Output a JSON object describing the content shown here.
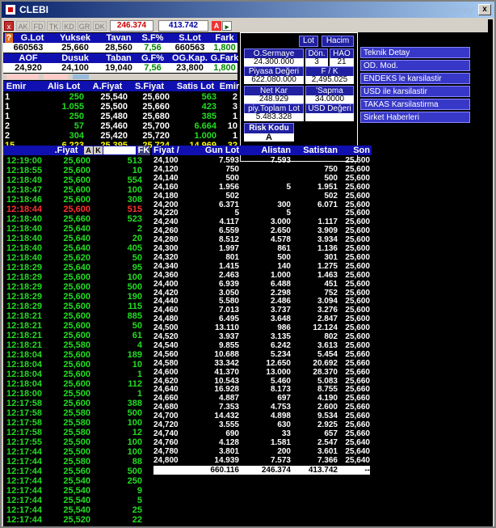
{
  "window": {
    "title": "CLEBI",
    "ghost_title": "Detay",
    "close": "x"
  },
  "toolbar": {
    "close_mark": "x",
    "tabs": [
      "AK",
      "FD",
      "TK",
      "KD",
      "GR",
      "DK"
    ],
    "price1": "246.374",
    "price2": "413.742",
    "a_label": "A"
  },
  "summary": {
    "headers1": [
      "?",
      "G.Lot",
      "Yuksek",
      "Tavan",
      "S.F%",
      "S.Lot",
      "Fark"
    ],
    "values1": [
      "660563",
      "25,660",
      "28,560",
      "7,56",
      "660563",
      "1,800"
    ],
    "headers2": [
      "AOF",
      "Dusuk",
      "Taban",
      "G.F%",
      "OG.Kap.",
      "G.Fark"
    ],
    "values2": [
      "24,920",
      "24,100",
      "19,040",
      "7,56",
      "23,800",
      "1,800"
    ]
  },
  "depth": {
    "headers": [
      "Emir",
      "Alis Lot",
      "A.Fiyat",
      "S.Fiyat",
      "Satis Lot",
      "Emir"
    ],
    "rows": [
      [
        "1",
        "250",
        "25,540",
        "25,600",
        "563",
        "2"
      ],
      [
        "1",
        "1.055",
        "25,500",
        "25,660",
        "423",
        "3"
      ],
      [
        "1",
        "250",
        "25,480",
        "25,680",
        "385",
        "1"
      ],
      [
        "2",
        "57",
        "25,460",
        "25,700",
        "6.664",
        "10"
      ],
      [
        "2",
        "304",
        "25,420",
        "25,720",
        "1.000",
        "1"
      ]
    ],
    "totals": [
      "15",
      "6.223",
      "25,395",
      "25,724",
      "14.969",
      "32"
    ]
  },
  "info": {
    "lot_btn": "Lot",
    "hacim_btn": "Hacim",
    "labels": {
      "sermaye": "O.Sermaye",
      "don": "Dön.",
      "hao": "HAO",
      "piyasa": "Piyasa Değeri",
      "fk": "F / K",
      "netkar": "Net Kar",
      "sapma": "'Sapma",
      "toplam": "piy.Toplam Lot",
      "usd": "USD Değeri",
      "risk": "Risk Kodu"
    },
    "values": {
      "sermaye": "24.300.000",
      "don": "3",
      "hao": "21",
      "piyasa": "622.080.000",
      "fk": "2,495.025",
      "netkar": "248.929",
      "sapma": "34.0000",
      "toplam": "5.483.328",
      "risk": "A"
    }
  },
  "menu": [
    "Teknik Detay",
    "OD. Mod.",
    "ENDEKS le karsilastir",
    "USD ile karsilastir",
    "TAKAS Karsilastirma",
    "Sirket Haberleri"
  ],
  "tape": {
    "headers": [
      "",
      ".Fiyat",
      "",
      "FK"
    ],
    "ak": [
      "A",
      "K"
    ],
    "rows": [
      [
        "12:19:00",
        "25,600",
        "513"
      ],
      [
        "12:18:55",
        "25,600",
        "10"
      ],
      [
        "12:18:49",
        "25,600",
        "554"
      ],
      [
        "12:18:47",
        "25,600",
        "100"
      ],
      [
        "12:18:46",
        "25,600",
        "308"
      ],
      [
        "12:18:44",
        "25,600",
        "515"
      ],
      [
        "12:18:40",
        "25,660",
        "523"
      ],
      [
        "12:18:40",
        "25,640",
        "2"
      ],
      [
        "12:18:40",
        "25,640",
        "20"
      ],
      [
        "12:18:40",
        "25,640",
        "405"
      ],
      [
        "12:18:40",
        "25,620",
        "50"
      ],
      [
        "12:18:29",
        "25,640",
        "95"
      ],
      [
        "12:18:29",
        "25,600",
        "100"
      ],
      [
        "12:18:29",
        "25,600",
        "500"
      ],
      [
        "12:18:29",
        "25,600",
        "190"
      ],
      [
        "12:18:29",
        "25,600",
        "115"
      ],
      [
        "12:18:21",
        "25,600",
        "885"
      ],
      [
        "12:18:21",
        "25,600",
        "50"
      ],
      [
        "12:18:21",
        "25,600",
        "61"
      ],
      [
        "12:18:21",
        "25,580",
        "4"
      ],
      [
        "12:18:04",
        "25,600",
        "189"
      ],
      [
        "12:18:04",
        "25,600",
        "10"
      ],
      [
        "12:18:04",
        "25,600",
        "1"
      ],
      [
        "12:18:04",
        "25,600",
        "112"
      ],
      [
        "12:18:00",
        "25,500",
        "1"
      ],
      [
        "12:17:58",
        "25,600",
        "388"
      ],
      [
        "12:17:58",
        "25,580",
        "500"
      ],
      [
        "12:17:58",
        "25,580",
        "100"
      ],
      [
        "12:17:58",
        "25,580",
        "12"
      ],
      [
        "12:17:55",
        "25,500",
        "100"
      ],
      [
        "12:17:44",
        "25,500",
        "100"
      ],
      [
        "12:17:44",
        "25,580",
        "88"
      ],
      [
        "12:17:44",
        "25,560",
        "500"
      ],
      [
        "12:17:44",
        "25,540",
        "250"
      ],
      [
        "12:17:44",
        "25,540",
        "9"
      ],
      [
        "12:17:44",
        "25,540",
        "5"
      ],
      [
        "12:17:44",
        "25,540",
        "25"
      ],
      [
        "12:17:44",
        "25,520",
        "22"
      ]
    ]
  },
  "priceladder": {
    "headers": [
      "Fiyat /",
      "Gun Lot",
      "Alistan",
      "Satistan",
      "Son"
    ],
    "rows": [
      [
        "24,100",
        "7.593",
        "7.593",
        "",
        "25,600"
      ],
      [
        "24,120",
        "750",
        "",
        "750",
        "25,600"
      ],
      [
        "24,140",
        "500",
        "",
        "500",
        "25,600"
      ],
      [
        "24,160",
        "1.956",
        "5",
        "1.951",
        "25,600"
      ],
      [
        "24,180",
        "502",
        "",
        "502",
        "25,600"
      ],
      [
        "24,200",
        "6.371",
        "300",
        "6.071",
        "25,600"
      ],
      [
        "24,220",
        "5",
        "5",
        "",
        "25,600"
      ],
      [
        "24,240",
        "4.117",
        "3.000",
        "1.117",
        "25,600"
      ],
      [
        "24,260",
        "6.559",
        "2.650",
        "3.909",
        "25,600"
      ],
      [
        "24,280",
        "8.512",
        "4.578",
        "3.934",
        "25,600"
      ],
      [
        "24,300",
        "1.997",
        "861",
        "1.136",
        "25,600"
      ],
      [
        "24,320",
        "801",
        "500",
        "301",
        "25,600"
      ],
      [
        "24,340",
        "1.415",
        "140",
        "1.275",
        "25,600"
      ],
      [
        "24,360",
        "2.463",
        "1.000",
        "1.463",
        "25,600"
      ],
      [
        "24,400",
        "6.939",
        "6.488",
        "451",
        "25,600"
      ],
      [
        "24,420",
        "3.050",
        "2.298",
        "752",
        "25,600"
      ],
      [
        "24,440",
        "5.580",
        "2.486",
        "3.094",
        "25,600"
      ],
      [
        "24,460",
        "7.013",
        "3.737",
        "3.276",
        "25,600"
      ],
      [
        "24,480",
        "6.495",
        "3.648",
        "2.847",
        "25,600"
      ],
      [
        "24,500",
        "13.110",
        "986",
        "12.124",
        "25,600"
      ],
      [
        "24,520",
        "3.937",
        "3.135",
        "802",
        "25,600"
      ],
      [
        "24,540",
        "9.855",
        "6.242",
        "3.613",
        "25,600"
      ],
      [
        "24,560",
        "10.688",
        "5.234",
        "5.454",
        "25,660"
      ],
      [
        "24,580",
        "33.342",
        "12.650",
        "20.692",
        "25,660"
      ],
      [
        "24,600",
        "41.370",
        "13.000",
        "28.370",
        "25,660"
      ],
      [
        "24,620",
        "10.543",
        "5.460",
        "5.083",
        "25,660"
      ],
      [
        "24,640",
        "16.928",
        "8.173",
        "8.755",
        "25,660"
      ],
      [
        "24,660",
        "4.887",
        "697",
        "4.190",
        "25,660"
      ],
      [
        "24,680",
        "7.353",
        "4.753",
        "2.600",
        "25,660"
      ],
      [
        "24,700",
        "14.432",
        "4.898",
        "9.534",
        "25,660"
      ],
      [
        "24,720",
        "3.555",
        "630",
        "2.925",
        "25,660"
      ],
      [
        "24,740",
        "690",
        "33",
        "657",
        "25,660"
      ],
      [
        "24,760",
        "4.128",
        "1.581",
        "2.547",
        "25,640"
      ],
      [
        "24,780",
        "3.801",
        "200",
        "3.601",
        "25,640"
      ],
      [
        "24,800",
        "14.939",
        "7.573",
        "7.366",
        "25,640"
      ]
    ],
    "totals": [
      "660.116",
      "246.374",
      "413.742",
      "--"
    ]
  }
}
